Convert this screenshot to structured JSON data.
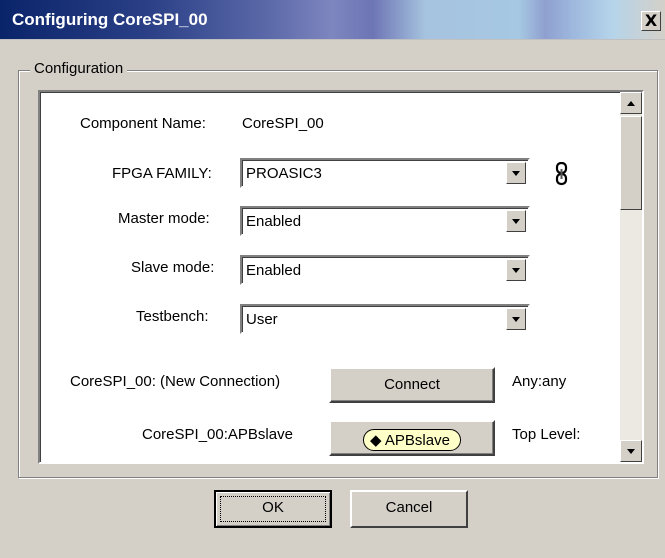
{
  "window": {
    "title": "Configuring CoreSPI_00",
    "close": "X"
  },
  "group": {
    "legend": "Configuration"
  },
  "form": {
    "component_name_label": "Component Name:",
    "component_name_value": "CoreSPI_00",
    "fpga_family_label": "FPGA FAMILY:",
    "fpga_family_value": "PROASIC3",
    "master_mode_label": "Master mode:",
    "master_mode_value": "Enabled",
    "slave_mode_label": "Slave mode:",
    "slave_mode_value": "Enabled",
    "testbench_label": "Testbench:",
    "testbench_value": "User"
  },
  "connections": [
    {
      "label": "CoreSPI_00: (New Connection)",
      "button": "Connect",
      "status": "Any:any"
    },
    {
      "label": "CoreSPI_00:APBslave",
      "button": "APBslave",
      "status": "Top Level:"
    }
  ],
  "buttons": {
    "ok": "OK",
    "cancel": "Cancel"
  },
  "icons": {
    "link": "chain-link-icon"
  }
}
